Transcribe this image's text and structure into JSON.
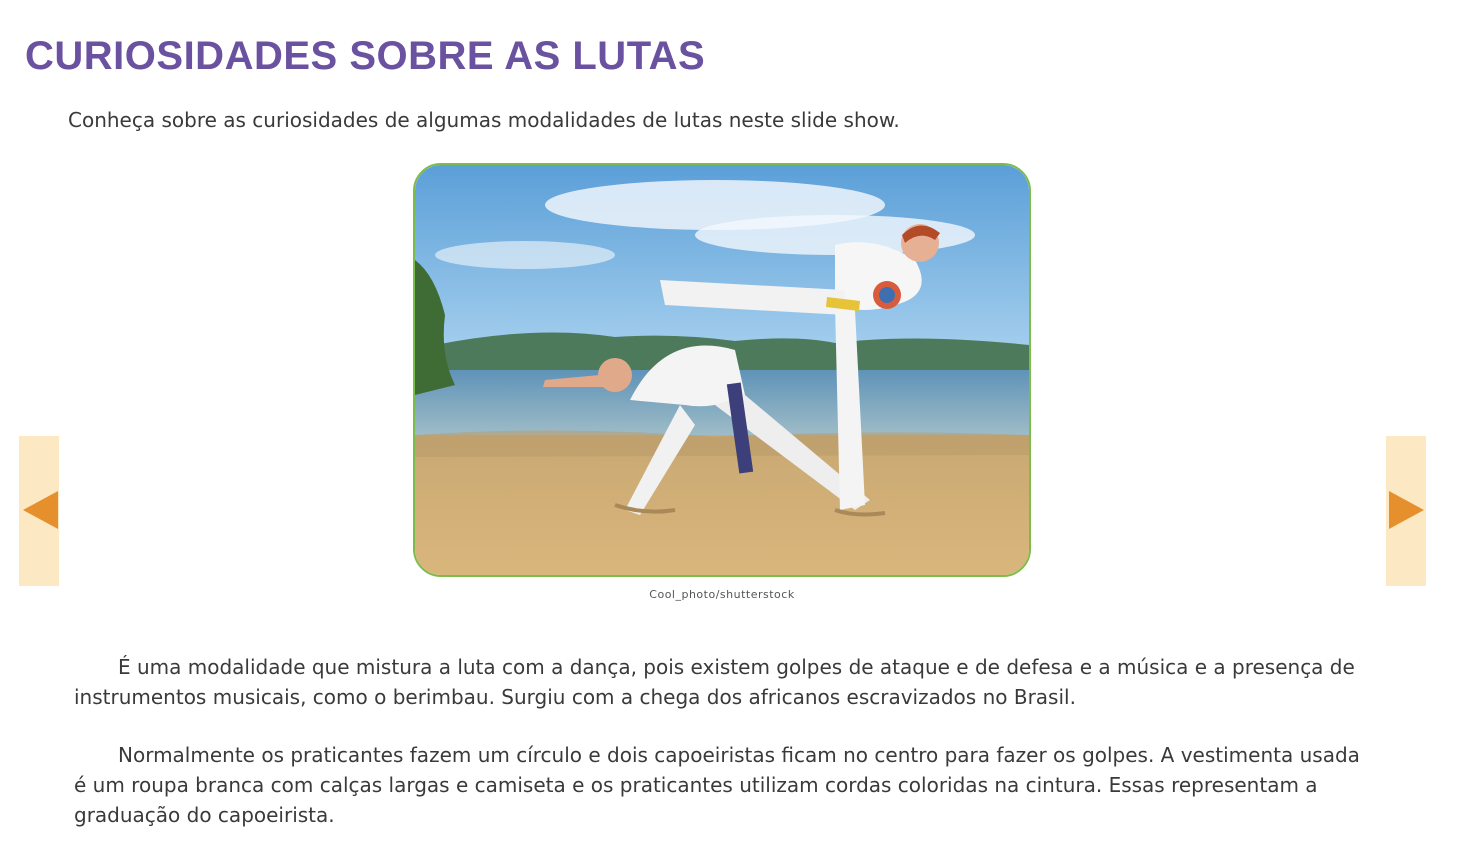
{
  "page": {
    "title": "CURIOSIDADES SOBRE AS LUTAS",
    "intro": "Conheça sobre as curiosidades de algumas modalidades de lutas neste slide show."
  },
  "slideshow": {
    "prev_icon": "triangle-left-icon",
    "next_icon": "triangle-right-icon",
    "credit": "Cool_photo/shutterstock"
  },
  "body": {
    "paragraphs": [
      "É uma modalidade que mistura a luta com a dança, pois existem golpes de ataque e de defesa e a música e a presença de instrumentos musicais, como o berimbau. Surgiu com a chega dos africanos escravizados no Brasil.",
      "Normalmente os praticantes fazem um círculo e dois capoeiristas ficam no centro para fazer os golpes. A vestimenta usada é um roupa branca com calças largas e camiseta e os praticantes utilizam cordas coloridas na cintura. Essas representam a graduação do capoeirista."
    ]
  },
  "colors": {
    "title": "#6a52a0",
    "nav_bg": "#fde8c4",
    "nav_arrow": "#e5902c",
    "frame_border": "#7dbb4a"
  }
}
